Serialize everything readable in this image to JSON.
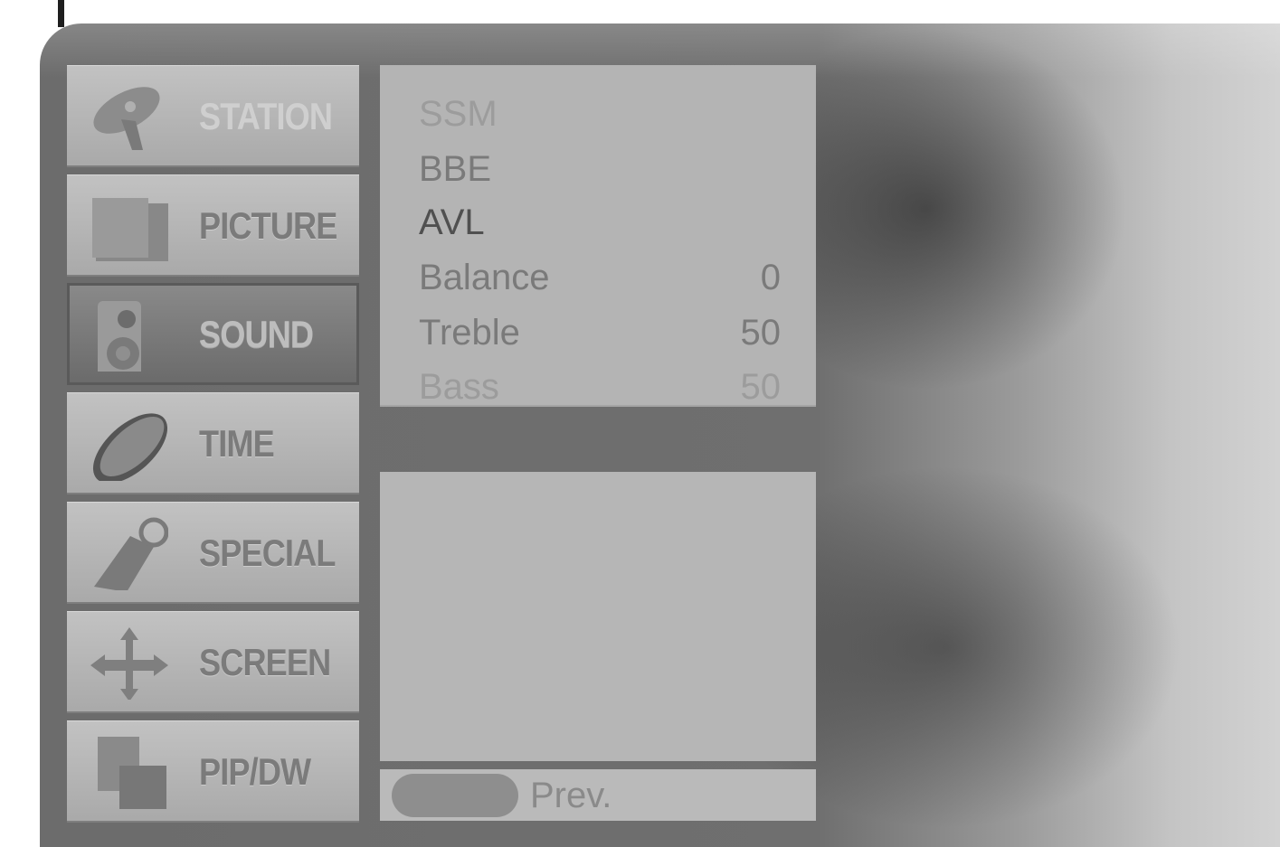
{
  "menu": {
    "items": [
      {
        "label": "STATION",
        "icon": "satellite-dish-icon"
      },
      {
        "label": "PICTURE",
        "icon": "picture-frame-icon"
      },
      {
        "label": "SOUND",
        "icon": "speaker-icon"
      },
      {
        "label": "TIME",
        "icon": "clock-icon"
      },
      {
        "label": "SPECIAL",
        "icon": "tag-icon"
      },
      {
        "label": "SCREEN",
        "icon": "move-arrows-icon"
      },
      {
        "label": "PIP/DW",
        "icon": "pip-window-icon"
      }
    ],
    "active": "SOUND"
  },
  "sound": {
    "options": [
      {
        "label": "SSM",
        "value": ""
      },
      {
        "label": "BBE",
        "value": ""
      },
      {
        "label": "AVL",
        "value": ""
      },
      {
        "label": "Balance",
        "value": "0"
      },
      {
        "label": "Treble",
        "value": "50"
      },
      {
        "label": "Bass",
        "value": "50"
      }
    ],
    "selected": "AVL"
  },
  "footer": {
    "prev_label": "Prev."
  },
  "colors": {
    "menu_item": "#b8b8b8",
    "menu_item_active": "#6f6f6f",
    "panel": "#b4b4b4",
    "background": "#6c6c6c"
  }
}
